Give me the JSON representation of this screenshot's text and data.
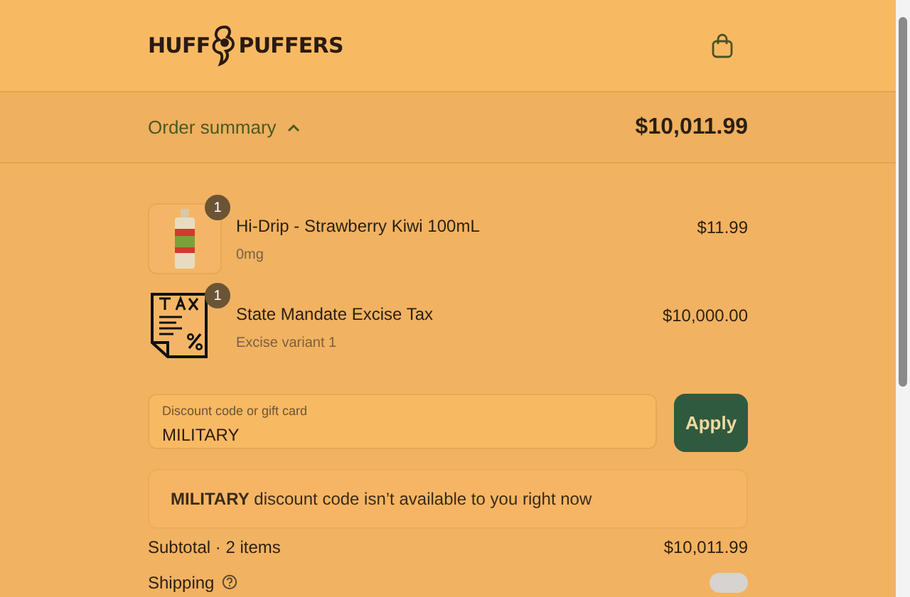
{
  "header": {
    "logo": [
      "HUFF",
      "PUFFERS"
    ]
  },
  "summary_bar": {
    "label": "Order summary",
    "expanded": true,
    "total": "$10,011.99"
  },
  "line_items": [
    {
      "kind": "product",
      "quantity": "1",
      "name": "Hi-Drip - Strawberry Kiwi 100mL",
      "variant": "0mg",
      "price": "$11.99"
    },
    {
      "kind": "tax",
      "quantity": "1",
      "name": "State Mandate Excise Tax",
      "variant": "Excise variant 1",
      "price": "$10,000.00"
    }
  ],
  "discount": {
    "label": "Discount code or gift card",
    "value": "MILITARY",
    "button": "Apply"
  },
  "error": "**MILITARY** discount code isn’t available to you right now",
  "totals": [
    {
      "label": "Subtotal · 2 items",
      "value": "$10,011.99",
      "help": false
    },
    {
      "label": "Shipping",
      "help": true
    }
  ]
}
